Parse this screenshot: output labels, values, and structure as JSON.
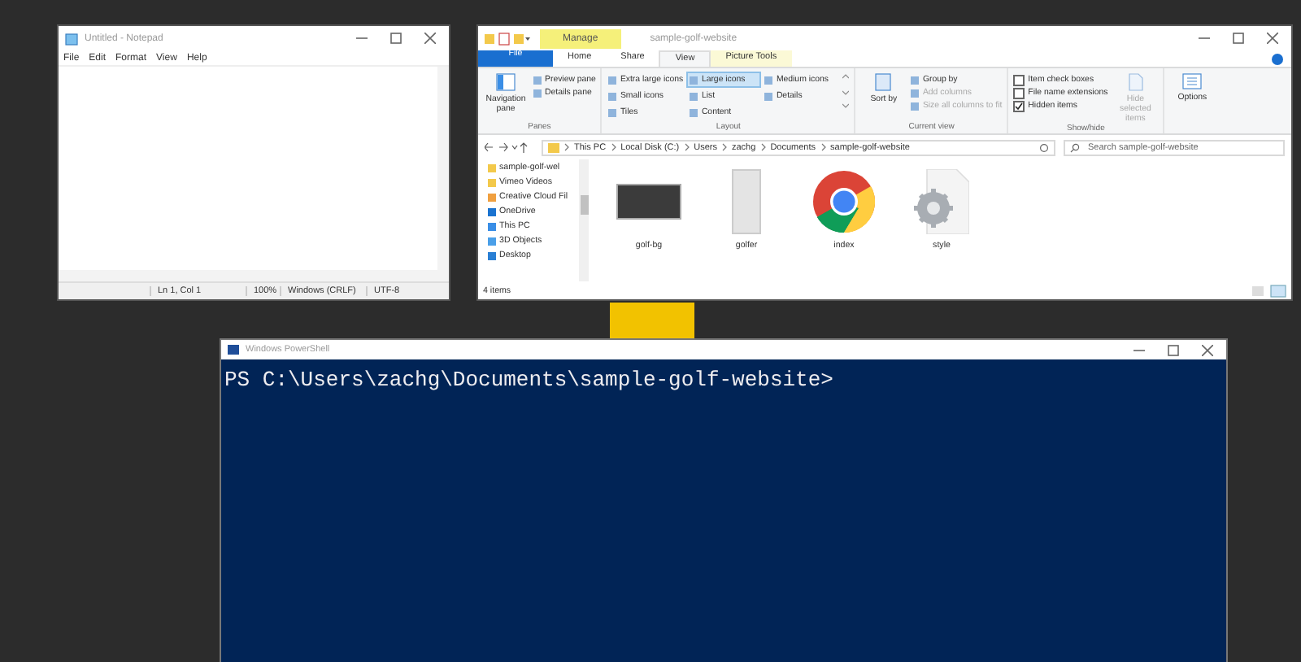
{
  "notepad": {
    "title": "Untitled - Notepad",
    "menu": [
      "File",
      "Edit",
      "Format",
      "View",
      "Help"
    ],
    "status": [
      "Ln 1, Col 1",
      "100%",
      "Windows (CRLF)",
      "UTF-8"
    ]
  },
  "explorer": {
    "title": "sample-golf-website",
    "context_tab": "Manage",
    "tabs": [
      {
        "label": "File",
        "kind": "file",
        "selected": false
      },
      {
        "label": "Home",
        "kind": "plain",
        "selected": false
      },
      {
        "label": "Share",
        "kind": "plain",
        "selected": false
      },
      {
        "label": "View",
        "kind": "plain",
        "selected": true
      },
      {
        "label": "Picture Tools",
        "kind": "context",
        "selected": false
      }
    ],
    "panes": {
      "navigation": "Navigation pane",
      "items": [
        "Preview pane",
        "Details pane"
      ],
      "label": "Panes"
    },
    "layout": {
      "items": [
        {
          "label": "Extra large icons",
          "selected": false
        },
        {
          "label": "Large icons",
          "selected": true
        },
        {
          "label": "Medium icons",
          "selected": false
        },
        {
          "label": "Small icons",
          "selected": false
        },
        {
          "label": "List",
          "selected": false
        },
        {
          "label": "Details",
          "selected": false
        },
        {
          "label": "Tiles",
          "selected": false
        },
        {
          "label": "Content",
          "selected": false
        }
      ],
      "label": "Layout"
    },
    "current_view": {
      "sort": "Sort by",
      "items": [
        {
          "label": "Group by",
          "disabled": false
        },
        {
          "label": "Add columns",
          "disabled": true
        },
        {
          "label": "Size all columns to fit",
          "disabled": true
        }
      ],
      "label": "Current view"
    },
    "show_hide": {
      "checkboxes": [
        {
          "label": "Item check boxes",
          "checked": false
        },
        {
          "label": "File name extensions",
          "checked": false
        },
        {
          "label": "Hidden items",
          "checked": true
        }
      ],
      "hide_selected": "Hide selected items",
      "label": "Show/hide"
    },
    "options": "Options",
    "breadcrumb": [
      "This PC",
      "Local Disk (C:)",
      "Users",
      "zachg",
      "Documents",
      "sample-golf-website"
    ],
    "search": {
      "placeholder": "Search sample-golf-website"
    },
    "nav_tree": [
      {
        "label": "sample-golf-wel",
        "kind": "folder"
      },
      {
        "label": "Vimeo Videos",
        "kind": "folder"
      },
      {
        "label": "Creative Cloud Fil",
        "kind": "cloud-folder"
      },
      {
        "label": "OneDrive",
        "kind": "cloud"
      },
      {
        "label": "This PC",
        "kind": "pc"
      },
      {
        "label": "3D Objects",
        "kind": "cube"
      },
      {
        "label": "Desktop",
        "kind": "desktop"
      }
    ],
    "files": [
      {
        "name": "golf-bg",
        "kind": "photo"
      },
      {
        "name": "golfer",
        "kind": "portrait"
      },
      {
        "name": "index",
        "kind": "browser"
      },
      {
        "name": "style",
        "kind": "stylesheet"
      }
    ],
    "status": "4 items"
  },
  "powershell": {
    "title": "Windows PowerShell",
    "prompt": "PS C:\\Users\\zachg\\Documents\\sample-golf-website>"
  }
}
